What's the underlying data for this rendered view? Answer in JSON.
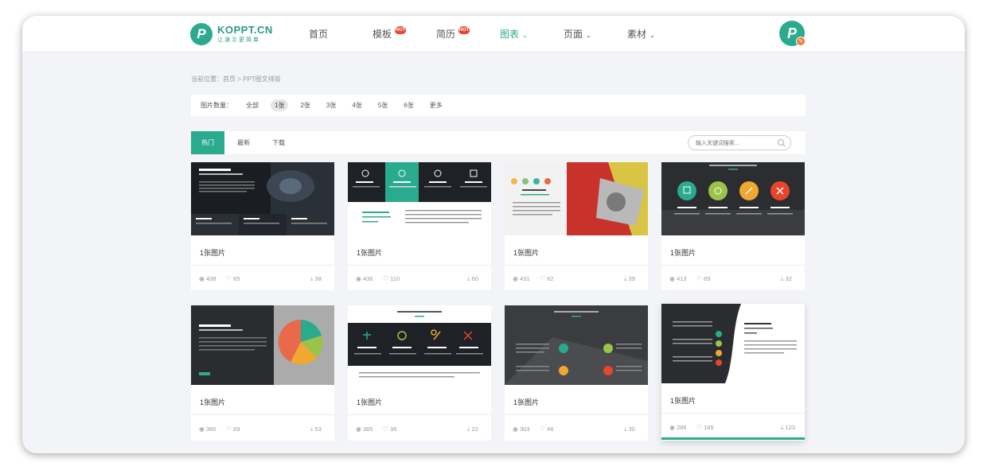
{
  "brand": {
    "name": "KOPPT.CN",
    "slogan": "让演示更简单",
    "logo_letter": "P",
    "accent": "#2bab8e"
  },
  "nav": [
    {
      "label": "首页",
      "hot": false,
      "dropdown": false
    },
    {
      "label": "模板",
      "hot": true,
      "dropdown": false
    },
    {
      "label": "简历",
      "hot": true,
      "dropdown": false
    },
    {
      "label": "图表",
      "hot": false,
      "dropdown": true,
      "active": true
    },
    {
      "label": "页面",
      "hot": false,
      "dropdown": true
    },
    {
      "label": "素材",
      "hot": false,
      "dropdown": true
    }
  ],
  "hot_badge": "HOT",
  "user": {
    "avatar_letter": "P"
  },
  "breadcrumb": "当前位置：首页 > PPT图文排版",
  "filter": {
    "label": "图片数量：",
    "options": [
      "全部",
      "1张",
      "2张",
      "3张",
      "4张",
      "5张",
      "6张",
      "更多"
    ],
    "selected": "1张"
  },
  "tabs": [
    "热门",
    "最新",
    "下载"
  ],
  "active_tab": "热门",
  "search": {
    "placeholder": "输入关键词搜索..."
  },
  "cards": [
    {
      "title": "1张图片",
      "views": "438",
      "likes": "65",
      "downloads": "38",
      "theme": "dark-car"
    },
    {
      "title": "1张图片",
      "views": "436",
      "likes": "110",
      "downloads": "60",
      "theme": "icons-top"
    },
    {
      "title": "1张图片",
      "views": "431",
      "likes": "62",
      "downloads": "39",
      "theme": "red-yellow"
    },
    {
      "title": "1张图片",
      "views": "413",
      "likes": "69",
      "downloads": "32",
      "theme": "circles"
    },
    {
      "title": "1张图片",
      "views": "385",
      "likes": "69",
      "downloads": "53",
      "theme": "pie"
    },
    {
      "title": "1张图片",
      "views": "385",
      "likes": "36",
      "downloads": "22",
      "theme": "icons-band"
    },
    {
      "title": "1张图片",
      "views": "303",
      "likes": "46",
      "downloads": "30",
      "theme": "gray-circles"
    },
    {
      "title": "1张图片",
      "views": "288",
      "likes": "165",
      "downloads": "123",
      "theme": "wave"
    }
  ]
}
